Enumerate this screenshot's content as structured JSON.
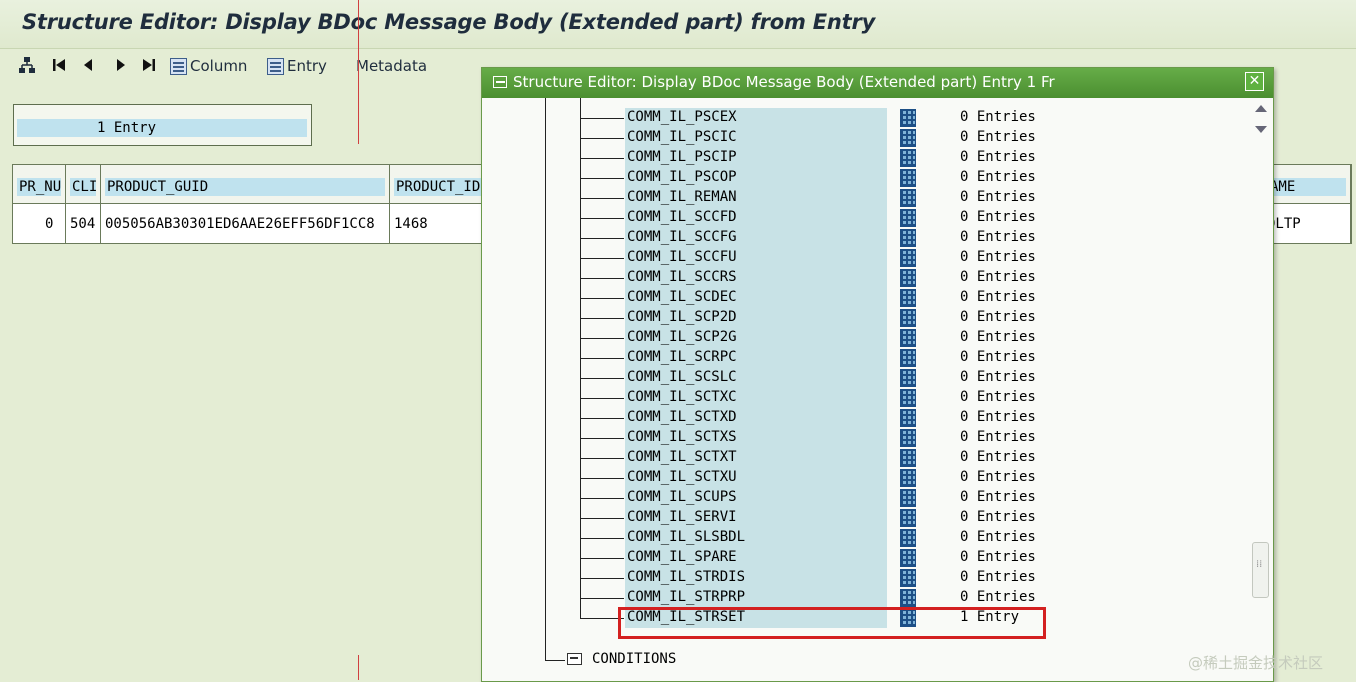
{
  "window": {
    "title": "Structure Editor: Display BDoc Message Body (Extended part) from Entry"
  },
  "toolbar": {
    "hierarchy_icon": "hierarchy-icon",
    "first_icon": "first-page-icon",
    "prev_icon": "previous-icon",
    "next_icon": "next-icon",
    "last_icon": "last-page-icon",
    "column_label": "Column",
    "entry_label": "Entry",
    "metadata_label": "Metadata"
  },
  "entry_box": {
    "text": "1 Entry"
  },
  "table": {
    "headers": [
      "PR_NU",
      "CLI",
      "PRODUCT_GUID",
      "PRODUCT_ID",
      "AME"
    ],
    "row": [
      "0",
      "504",
      "005056AB30301ED6AAE26EFF56DF1CC8",
      "1468",
      "DLTP"
    ]
  },
  "dialog": {
    "title": "Structure Editor: Display BDoc Message Body (Extended part) Entry 1 Fr",
    "close": "✕",
    "tree_items": [
      {
        "name": "COMM_IL_PSCEX",
        "count": "0 Entries"
      },
      {
        "name": "COMM_IL_PSCIC",
        "count": "0 Entries"
      },
      {
        "name": "COMM_IL_PSCIP",
        "count": "0 Entries"
      },
      {
        "name": "COMM_IL_PSCOP",
        "count": "0 Entries"
      },
      {
        "name": "COMM_IL_REMAN",
        "count": "0 Entries"
      },
      {
        "name": "COMM_IL_SCCFD",
        "count": "0 Entries"
      },
      {
        "name": "COMM_IL_SCCFG",
        "count": "0 Entries"
      },
      {
        "name": "COMM_IL_SCCFU",
        "count": "0 Entries"
      },
      {
        "name": "COMM_IL_SCCRS",
        "count": "0 Entries"
      },
      {
        "name": "COMM_IL_SCDEC",
        "count": "0 Entries"
      },
      {
        "name": "COMM_IL_SCP2D",
        "count": "0 Entries"
      },
      {
        "name": "COMM_IL_SCP2G",
        "count": "0 Entries"
      },
      {
        "name": "COMM_IL_SCRPC",
        "count": "0 Entries"
      },
      {
        "name": "COMM_IL_SCSLC",
        "count": "0 Entries"
      },
      {
        "name": "COMM_IL_SCTXC",
        "count": "0 Entries"
      },
      {
        "name": "COMM_IL_SCTXD",
        "count": "0 Entries"
      },
      {
        "name": "COMM_IL_SCTXS",
        "count": "0 Entries"
      },
      {
        "name": "COMM_IL_SCTXT",
        "count": "0 Entries"
      },
      {
        "name": "COMM_IL_SCTXU",
        "count": "0 Entries"
      },
      {
        "name": "COMM_IL_SCUPS",
        "count": "0 Entries"
      },
      {
        "name": "COMM_IL_SERVI",
        "count": "0 Entries"
      },
      {
        "name": "COMM_IL_SLSBDL",
        "count": "0 Entries"
      },
      {
        "name": "COMM_IL_SPARE",
        "count": "0 Entries"
      },
      {
        "name": "COMM_IL_STRDIS",
        "count": "0 Entries"
      },
      {
        "name": "COMM_IL_STRPRP",
        "count": "0 Entries"
      },
      {
        "name": "COMM_IL_STRSET",
        "count": "1 Entry"
      }
    ],
    "conditions_label": "CONDITIONS"
  },
  "watermark": "@稀土掘金技术社区",
  "colors": {
    "dialog_title": "#4b8f30",
    "highlight": "#d32020",
    "field_bg": "#bfe2ee"
  }
}
